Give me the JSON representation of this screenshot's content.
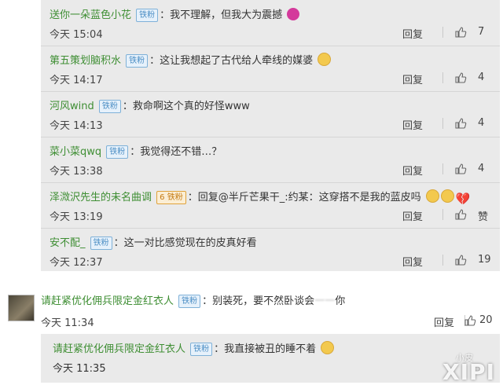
{
  "comments": [
    {
      "username": "送你一朵蓝色小花",
      "badge": "铁粉",
      "text": "我不理解，但我大为震撼",
      "emojis": [
        "pink-sticker"
      ],
      "time": "今天 15:04",
      "reply_label": "回复",
      "likes": "7"
    },
    {
      "username": "第五策划脑积水",
      "badge": "铁粉",
      "text": "这让我想起了古代给人牵线的媒婆",
      "emojis": [
        "doge-face"
      ],
      "time": "今天 14:17",
      "reply_label": "回复",
      "likes": "4"
    },
    {
      "username": "河风wind",
      "badge": "铁粉",
      "text": "救命啊这个真的好怪www",
      "emojis": [],
      "time": "今天 14:13",
      "reply_label": "回复",
      "likes": "4"
    },
    {
      "username": "菜小菜qwq",
      "badge": "铁粉",
      "text": "我觉得还不错…？",
      "emojis": [],
      "time": "今天 13:38",
      "reply_label": "回复",
      "likes": "4"
    },
    {
      "username": "泽溦沢先生的未名曲调",
      "badge": "铁粉",
      "badge_level": "6",
      "text": "回复@半斤芒果干_:约某：这穿搭不是我的蓝皮吗",
      "emojis": [
        "doge-face",
        "doge-face",
        "broken-heart"
      ],
      "time": "今天 13:19",
      "reply_label": "回复",
      "likes": "赞"
    },
    {
      "username": "安不配_",
      "badge": "铁粉",
      "text": "这一对比感觉现在的皮真好看",
      "emojis": [],
      "time": "今天 12:37",
      "reply_label": "回复",
      "likes": "19"
    }
  ],
  "main_comment": {
    "username": "请赶紧优化佣兵限定金红衣人",
    "badge": "铁粉",
    "text_part1": "别装死，要不然卧谈会",
    "text_blurred": "一一",
    "text_part2": "你",
    "time": "今天 11:34",
    "reply_label": "回复",
    "likes": "20"
  },
  "sub_comment": {
    "username": "请赶紧优化佣兵限定金红衣人",
    "badge": "铁粉",
    "text": "我直接被丑的睡不着",
    "emoji": "sleepy-face",
    "time": "今天 11:35"
  },
  "watermark": {
    "small": "小皮",
    "large": "XIPI"
  },
  "colors": {
    "username": "#3e8e33",
    "panel_bg": "#eaeaea",
    "badge_blue": "#4d8fc5"
  }
}
